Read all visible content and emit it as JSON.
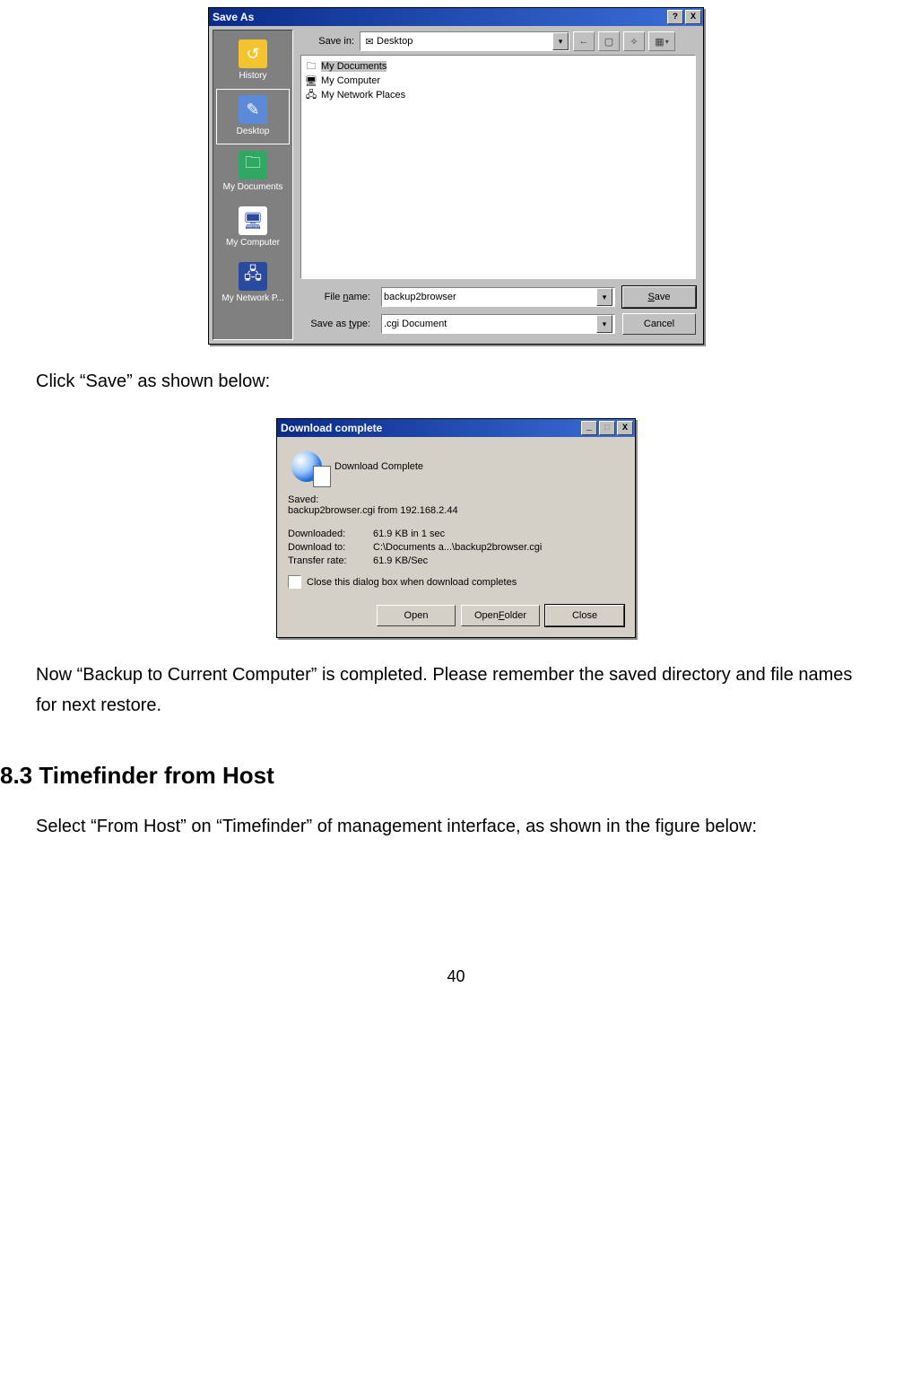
{
  "save_as": {
    "title": "Save As",
    "save_in_label": "Save in:",
    "save_in_value": "Desktop",
    "places": {
      "history": "History",
      "desktop": "Desktop",
      "my_documents": "My Documents",
      "my_computer": "My Computer",
      "my_network": "My Network P..."
    },
    "file_list": {
      "my_documents": "My Documents",
      "my_computer": "My Computer",
      "my_network_places": "My Network Places"
    },
    "file_name_label": "File name:",
    "file_name_value": "backup2browser",
    "save_as_type_label": "Save as type:",
    "save_as_type_value": ".cgi Document",
    "save_btn": "Save",
    "cancel_btn": "Cancel",
    "help_btn": "?",
    "close_btn": "X",
    "back_glyph": "←",
    "up_glyph": "▢",
    "newfolder_glyph": "✧",
    "views_glyph": "▦",
    "dd_glyph": "▾"
  },
  "para1": "Click “Save” as shown below:",
  "dc": {
    "title": "Download complete",
    "minimize": "_",
    "maximize": "□",
    "close": "X",
    "heading": "Download Complete",
    "saved_label": "Saved:",
    "saved_value": "backup2browser.cgi from 192.168.2.44",
    "downloaded_k": "Downloaded:",
    "downloaded_v": "61.9 KB in 1 sec",
    "download_to_k": "Download to:",
    "download_to_v": "C:\\Documents a...\\backup2browser.cgi",
    "transfer_rate_k": "Transfer rate:",
    "transfer_rate_v": "61.9 KB/Sec",
    "close_checkbox": "Close this dialog box when download completes",
    "open_btn": "Open",
    "open_folder_btn": "Open Folder",
    "close_btn": "Close"
  },
  "para2": "Now “Backup to Current Computer” is completed. Please remember the saved directory and file names for next restore.",
  "heading": "8.3 Timefinder from Host",
  "para3": "Select “From Host” on “Timefinder” of management interface, as shown in the figure below:",
  "page_number": "40"
}
